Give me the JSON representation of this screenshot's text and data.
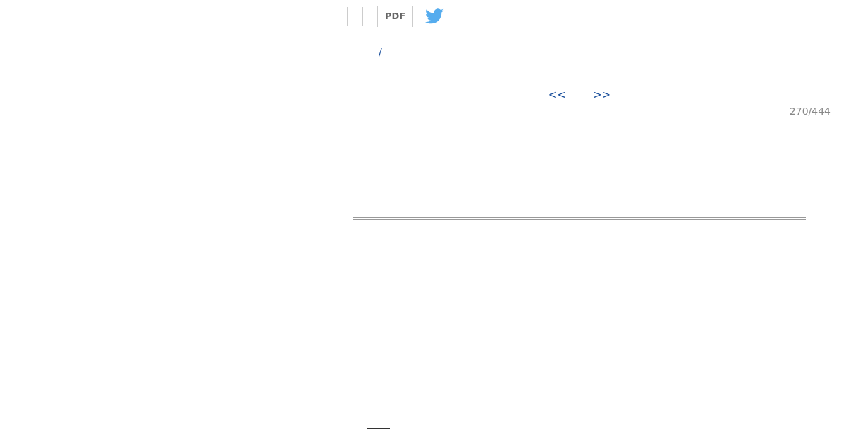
{
  "toolbar": {
    "pdf_label": "PDF"
  },
  "breadcrumb": {
    "separator": "/"
  },
  "pager": {
    "prev": "<<",
    "next": ">>",
    "position": "270/444"
  }
}
